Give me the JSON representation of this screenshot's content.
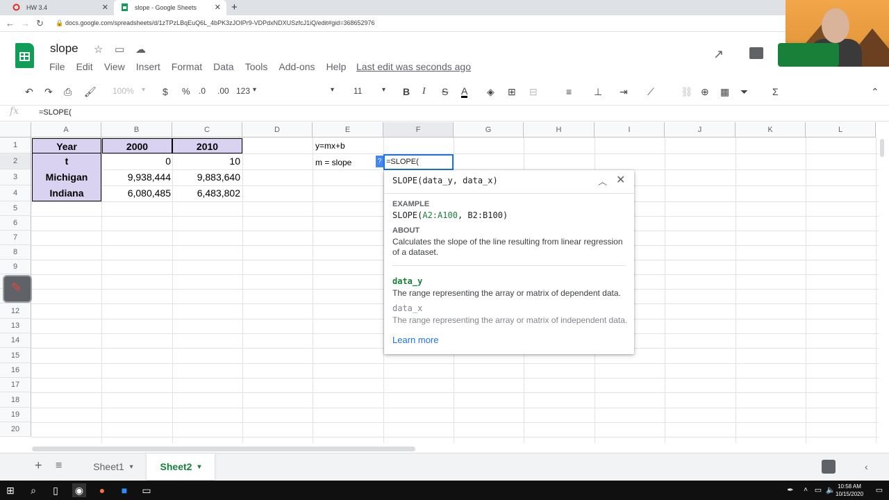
{
  "browser": {
    "tabs": [
      {
        "title": "HW 3.4",
        "active": false
      },
      {
        "title": "slope - Google Sheets",
        "active": true
      }
    ],
    "url": "docs.google.com/spreadsheets/d/1zTPzLBqEuQ6L_4bPK3zJOIPr9-VDPdxNDXUSzfcJ1iQ/edit#gid=368652976"
  },
  "doc": {
    "title": "slope",
    "menu": [
      "File",
      "Edit",
      "View",
      "Insert",
      "Format",
      "Data",
      "Tools",
      "Add-ons",
      "Help"
    ],
    "last_edit": "Last edit was seconds ago"
  },
  "toolbar": {
    "zoom": "100%",
    "currency": "$",
    "percent": "%",
    "dec_less": ".0",
    "dec_more": ".00",
    "format": "123",
    "font_size": "11",
    "bold": "B",
    "italic": "I",
    "strike": "S",
    "text_color": "A"
  },
  "formula_bar": {
    "fx": "fx",
    "content": "=SLOPE("
  },
  "columns": [
    "A",
    "B",
    "C",
    "D",
    "E",
    "F",
    "G",
    "H",
    "I",
    "J",
    "K",
    "L"
  ],
  "rows": [
    "1",
    "2",
    "3",
    "4",
    "5",
    "6",
    "7",
    "8",
    "9",
    "12",
    "13",
    "14",
    "15",
    "16",
    "17",
    "18",
    "19",
    "20"
  ],
  "cells": {
    "A1": "Year",
    "B1": "2000",
    "C1": "2010",
    "A2": "t",
    "B2": "0",
    "C2": "10",
    "A3": "Michigan",
    "B3": "9,938,444",
    "C3": "9,883,640",
    "A4": "Indiana",
    "B4": "6,080,485",
    "C4": "6,483,802",
    "E1": "y=mx+b",
    "E2": "m = slope",
    "F2": "=SLOPE("
  },
  "formula_help": {
    "badge": "?",
    "signature_fn": "SLOPE(",
    "signature_p1": "data_y",
    "signature_sep": ", ",
    "signature_p2": "data_x",
    "signature_end": ")",
    "example_label": "EXAMPLE",
    "example_fn": "SLOPE(",
    "example_arg1": "A2:A100",
    "example_rest": ", B2:B100)",
    "about_label": "ABOUT",
    "about_text": "Calculates the slope of the line resulting from linear regression of a dataset.",
    "param1_name": "data_y",
    "param1_desc": "The range representing the array or matrix of dependent data.",
    "param2_name": "data_x",
    "param2_desc": "The range representing the array or matrix of independent data.",
    "learn_more": "Learn more"
  },
  "sheets": [
    {
      "name": "Sheet1",
      "active": false
    },
    {
      "name": "Sheet2",
      "active": true
    }
  ],
  "clock": {
    "time": "10:58 AM",
    "date": "10/15/2020"
  },
  "colors": {
    "accent": "#1a73e8",
    "header_fill": "#d9d2f0",
    "sheets_green": "#188038"
  }
}
